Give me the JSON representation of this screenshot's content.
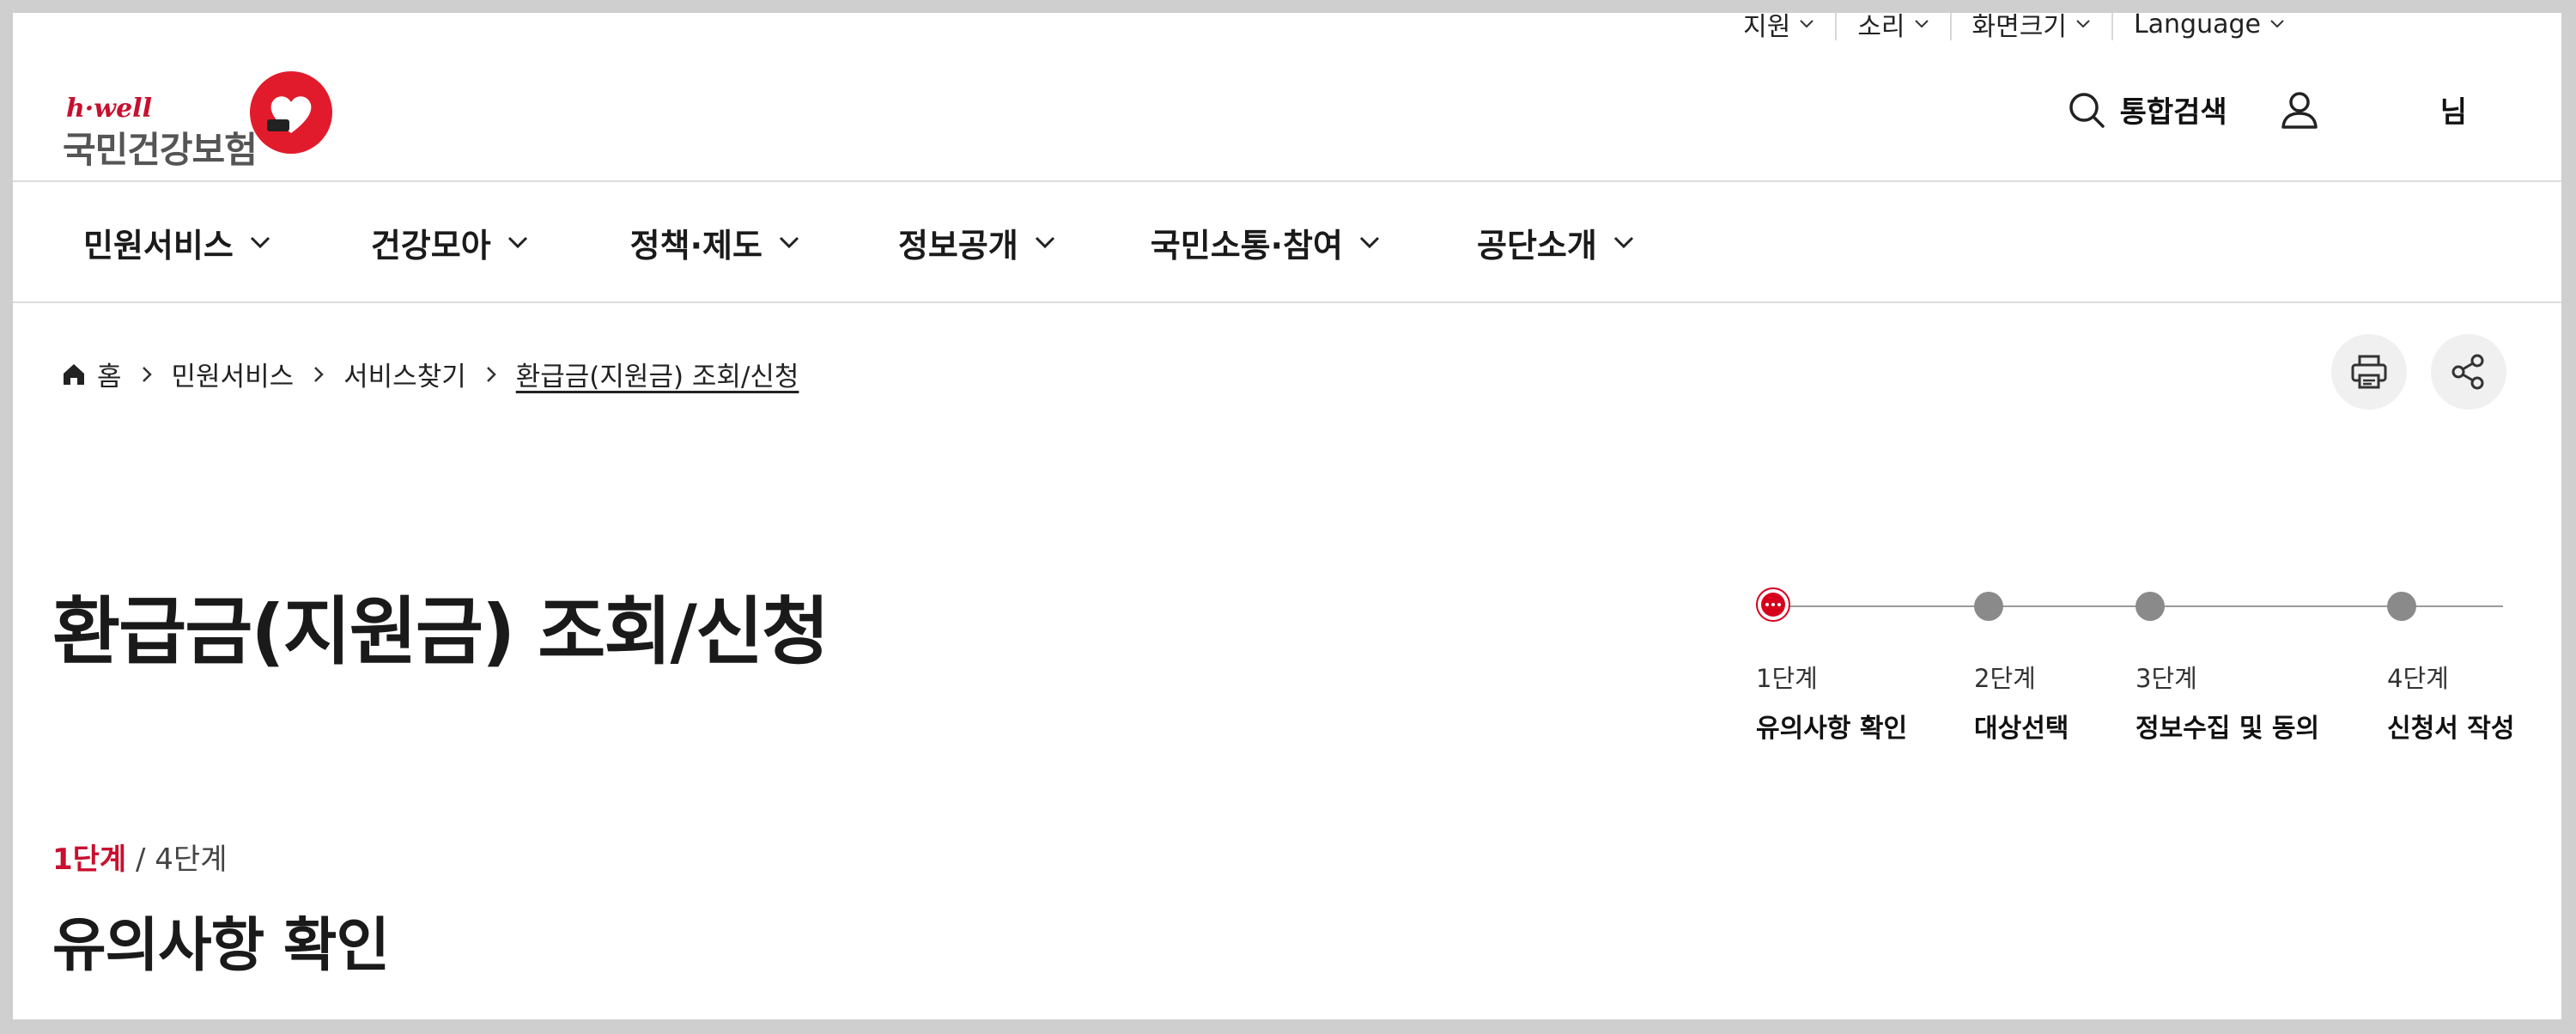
{
  "utility": {
    "items": [
      {
        "label": "지원"
      },
      {
        "label": "소리"
      },
      {
        "label": "화면크기"
      },
      {
        "label": "Language"
      }
    ]
  },
  "header": {
    "logo_tagline": "h·well",
    "logo_name": "국민건강보험",
    "search_label": "통합검색",
    "user_label": "님"
  },
  "gnb": {
    "items": [
      {
        "label": "민원서비스"
      },
      {
        "label": "건강모아"
      },
      {
        "label": "정책·제도"
      },
      {
        "label": "정보공개"
      },
      {
        "label": "국민소통·참여"
      },
      {
        "label": "공단소개"
      }
    ]
  },
  "breadcrumb": {
    "home": "홈",
    "items": [
      "민원서비스",
      "서비스찾기"
    ],
    "current": "환급금(지원금) 조회/신청"
  },
  "page": {
    "title": "환급금(지원금) 조회/신청"
  },
  "stepper": {
    "steps": [
      {
        "num": "1단계",
        "name": "유의사항 확인",
        "active": true
      },
      {
        "num": "2단계",
        "name": "대상선택",
        "active": false
      },
      {
        "num": "3단계",
        "name": "정보수집 및 동의",
        "active": false
      },
      {
        "num": "4단계",
        "name": "신청서 작성",
        "active": false
      }
    ]
  },
  "step_indicator": {
    "current": "1단계",
    "separator": " / ",
    "total": "4단계"
  },
  "section": {
    "title": "유의사항 확인"
  },
  "colors": {
    "brand_red": "#c8102e",
    "step_inactive": "#8a8a8a"
  }
}
